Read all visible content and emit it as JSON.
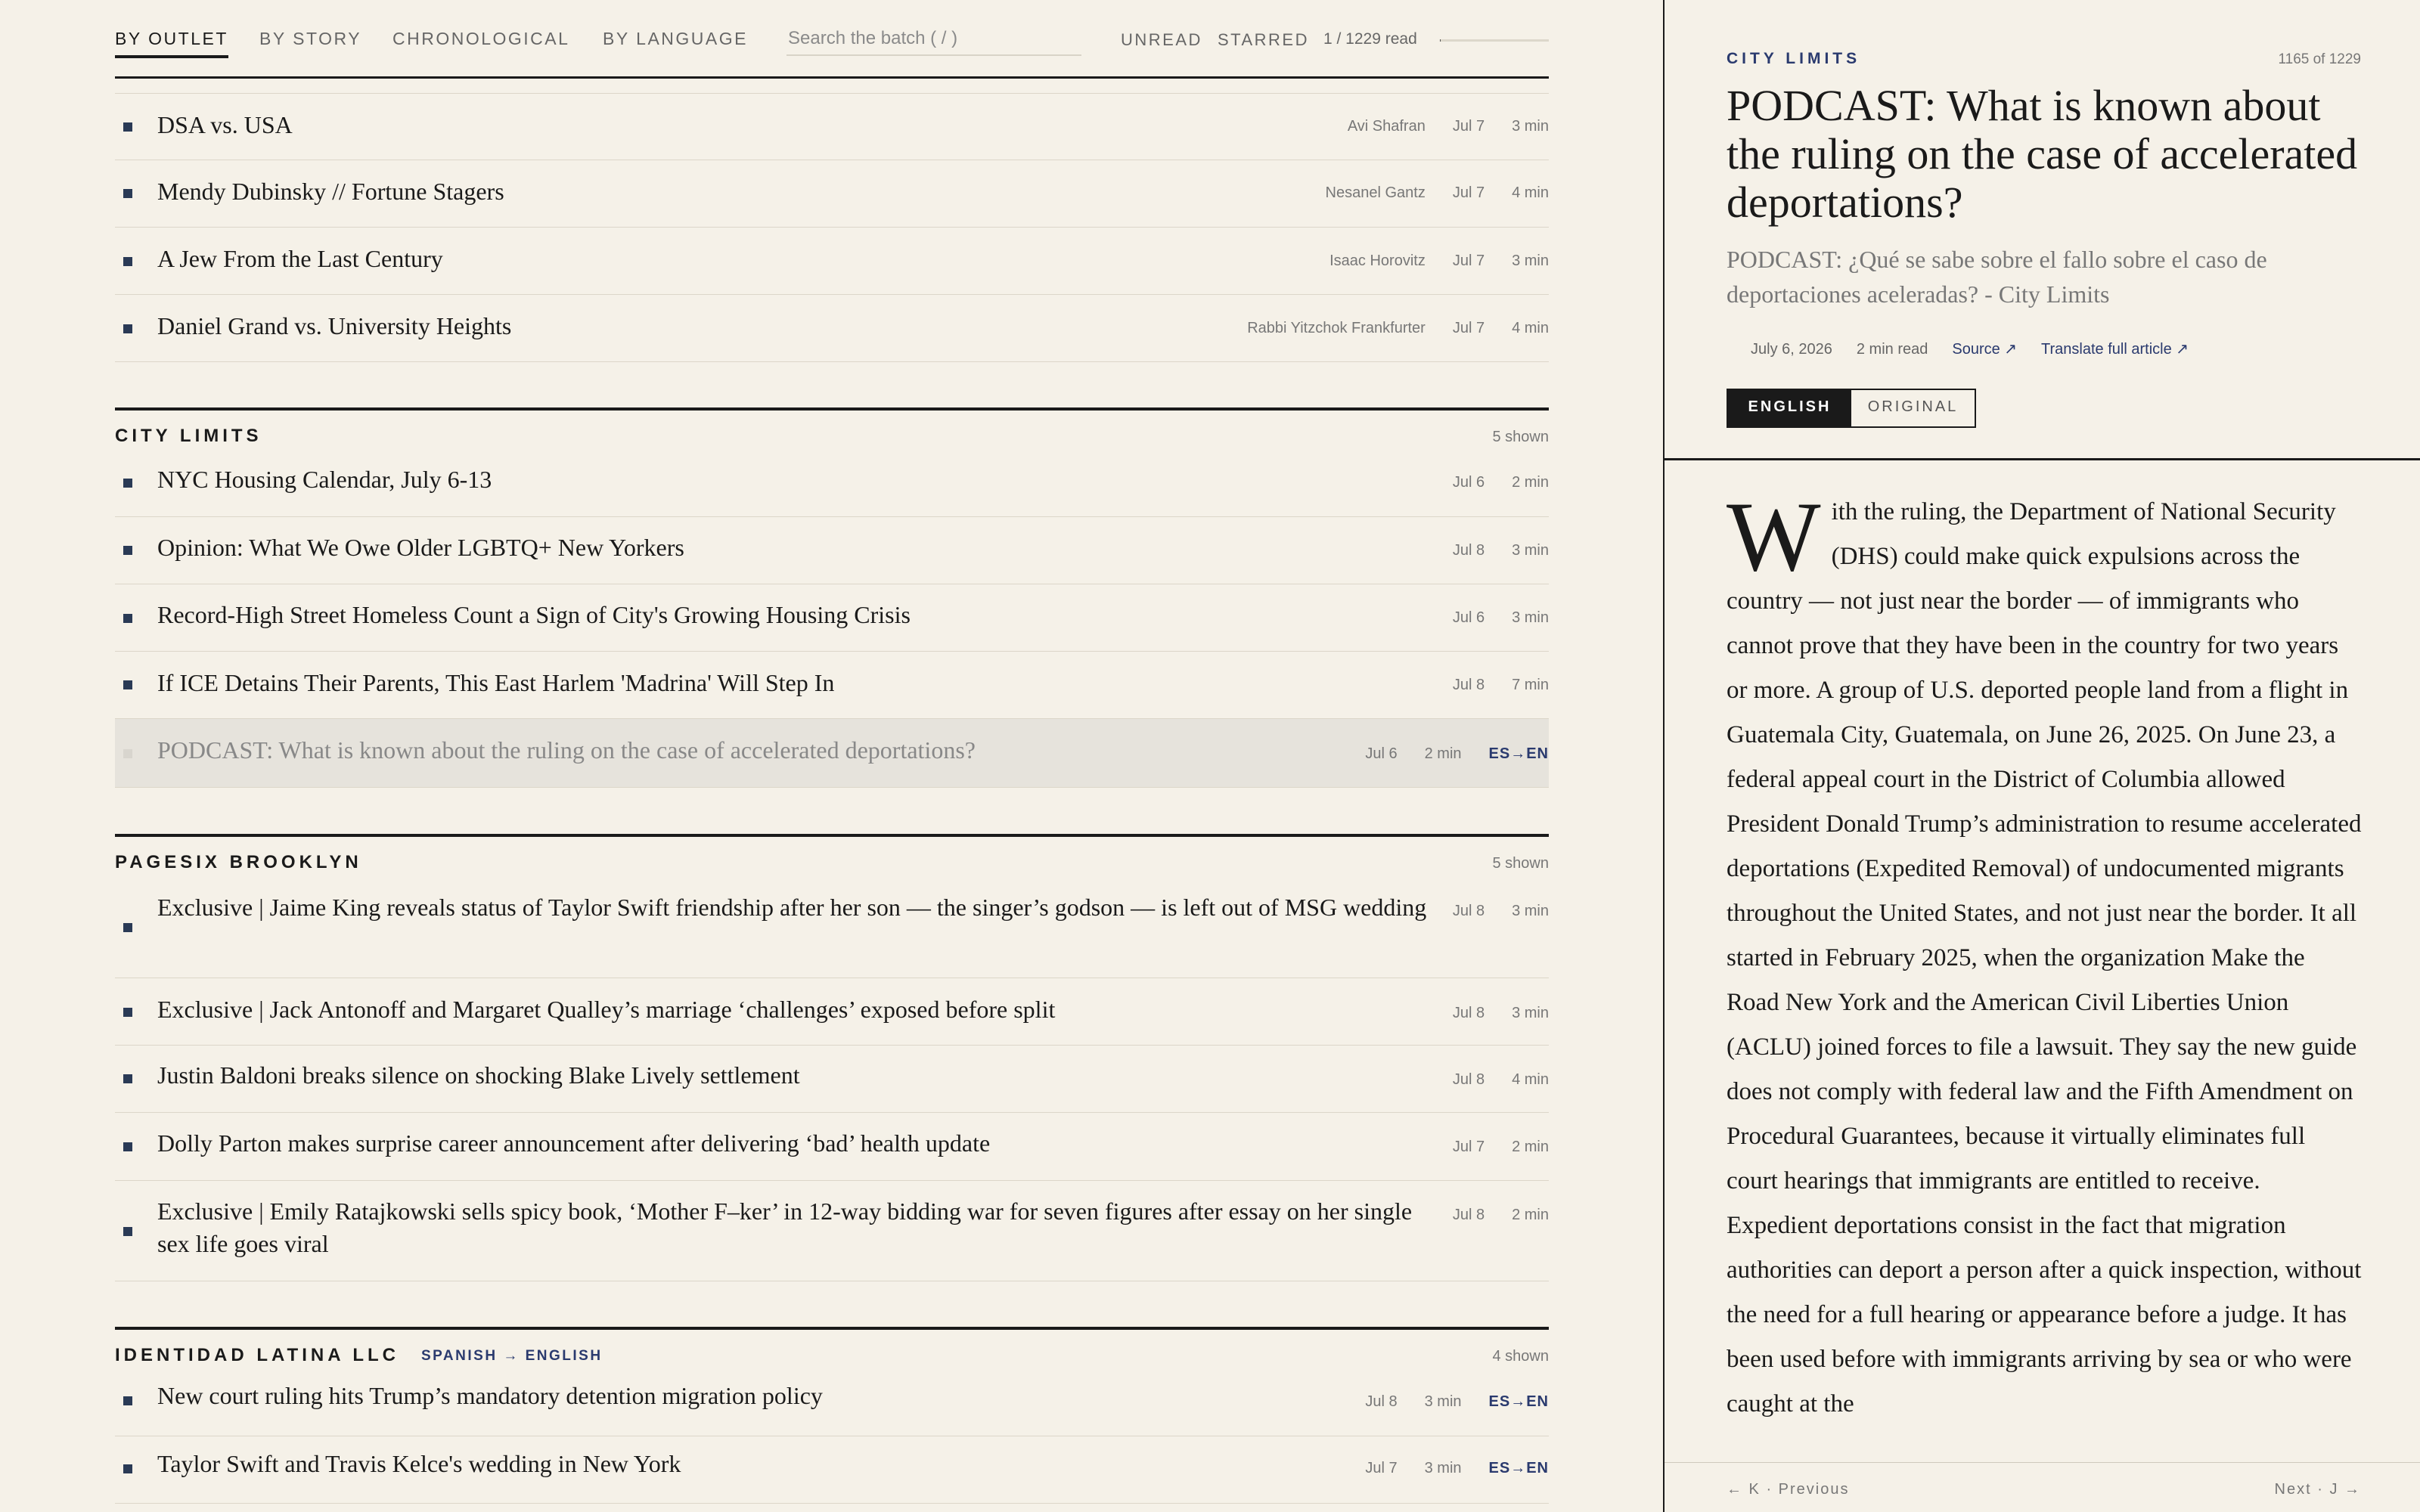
{
  "nav": {
    "tabs": [
      "By Outlet",
      "By Story",
      "Chronological",
      "By Language"
    ],
    "search_placeholder": "Search the batch ( / )",
    "toggles": [
      "Unread",
      "Starred"
    ],
    "read_count": "1 / 1229 read",
    "read_progress": 0.0008
  },
  "colors": {
    "background": "#f5f1e8",
    "accent": "#2a3a6e",
    "ink": "#1a1a1a",
    "selected_row": "#e6e3dc"
  },
  "top_items": [
    {
      "title": "DSA vs. USA",
      "author": "Avi Shafran",
      "date": "Jul 7",
      "read": "3 min"
    },
    {
      "title": "Mendy Dubinsky // Fortune Stagers",
      "author": "Nesanel Gantz",
      "date": "Jul 7",
      "read": "4 min"
    },
    {
      "title": "A Jew From the Last Century",
      "author": "Isaac Horovitz",
      "date": "Jul 7",
      "read": "3 min"
    },
    {
      "title": "Daniel Grand vs. University Heights",
      "author": "Rabbi Yitzchok Frankfurter",
      "date": "Jul 7",
      "read": "4 min"
    }
  ],
  "sections": [
    {
      "name": "City Limits",
      "shown": "5 shown",
      "items": [
        {
          "title": "NYC Housing Calendar, July 6-13",
          "date": "Jul 6",
          "read": "2 min"
        },
        {
          "title": "Opinion: What We Owe Older LGBTQ+ New Yorkers",
          "date": "Jul 8",
          "read": "3 min"
        },
        {
          "title": "Record-High Street Homeless Count a Sign of City's Growing Housing Crisis",
          "date": "Jul 6",
          "read": "3 min"
        },
        {
          "title": "If ICE Detains Their Parents, This East Harlem 'Madrina' Will Step In",
          "date": "Jul 8",
          "read": "7 min"
        },
        {
          "title": "PODCAST: What is known about the ruling on the case of accelerated deportations?",
          "date": "Jul 6",
          "read": "2 min",
          "lang": "ES→EN"
        }
      ]
    },
    {
      "name": "Pagesix Brooklyn",
      "shown": "5 shown",
      "items": [
        {
          "title": "Exclusive | Jaime King reveals status of Taylor Swift friendship after her son — the singer’s godson — is left out of MSG wedding",
          "date": "Jul 8",
          "read": "3 min"
        },
        {
          "title": "Exclusive | Jack Antonoff and Margaret Qualley’s marriage ‘challenges’ exposed before split",
          "date": "Jul 8",
          "read": "3 min"
        },
        {
          "title": "Justin Baldoni breaks silence on shocking Blake Lively settlement",
          "date": "Jul 8",
          "read": "4 min"
        },
        {
          "title": "Dolly Parton makes surprise career announcement after delivering ‘bad’ health update",
          "date": "Jul 7",
          "read": "2 min"
        },
        {
          "title": "Exclusive | Emily Ratajkowski sells spicy book, ‘Mother F–ker’ in 12-way bidding war for seven figures after essay on her single sex life goes viral",
          "date": "Jul 8",
          "read": "2 min"
        }
      ]
    },
    {
      "name": "Identidad Latina LLC",
      "sub": "Spanish → English",
      "shown": "4 shown",
      "items": [
        {
          "title": "New court ruling hits Trump’s mandatory detention migration policy",
          "date": "Jul 8",
          "read": "3 min",
          "lang": "ES→EN"
        },
        {
          "title": "Taylor Swift and Travis Kelce's wedding in New York",
          "date": "Jul 7",
          "read": "3 min",
          "lang": "ES→EN"
        }
      ]
    }
  ],
  "reader": {
    "outlet": "City Limits",
    "position": "1165 of 1229",
    "title": "PODCAST: What is known about the ruling on the case of accelerated deportations?",
    "original_title": "PODCAST: ¿Qué se sabe sobre el fallo sobre el caso de deportaciones aceleradas? - City Limits",
    "date": "July 6, 2026",
    "read_time": "2 min read",
    "source_label": "Source ↗",
    "translate_label": "Translate full article ↗",
    "lang_options": [
      "English",
      "Original"
    ],
    "drop_cap": "W",
    "body": "ith the ruling, the Department of National Security (DHS) could make quick expulsions across the country — not just near the border — of immigrants who cannot prove that they have been in the country for two years or more. A group of U.S. deported people land from a flight in Guatemala City, Guatemala, on June 26, 2025. On June 23, a federal appeal court in the District of Columbia allowed President Donald Trump’s administration to resume accelerated deportations (Expedited Removal) of undocumented migrants throughout the United States, and not just near the border. It all started in February 2025, when the organization Make the Road New York and the American Civil Liberties Union (ACLU) joined forces to file a lawsuit. They say the new guide does not comply with federal law and the Fifth Amendment on Procedural Guarantees, because it virtually eliminates full court hearings that immigrants are entitled to receive. Expedient deportations consist in the fact that migration authorities can deport a person after a quick inspection, without the need for a full hearing or appearance before a judge. It has been used before with immigrants arriving by sea or who were caught at the",
    "prev_label": "← K · Previous",
    "next_label": "Next · J →"
  }
}
